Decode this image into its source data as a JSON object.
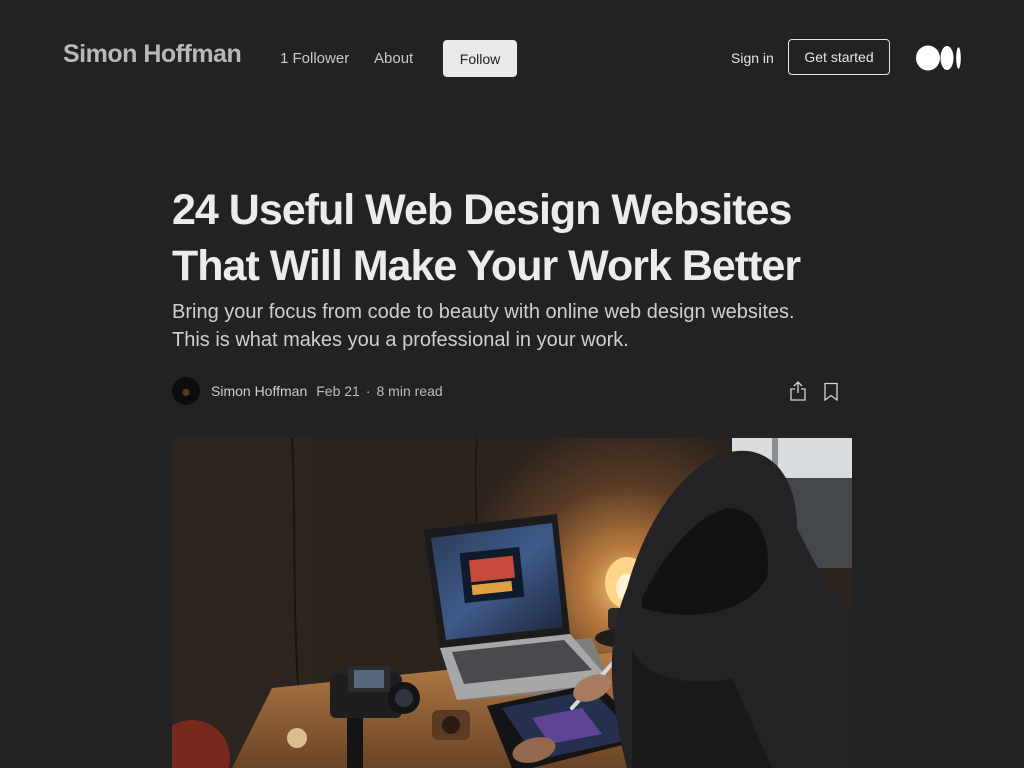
{
  "header": {
    "brand": "Simon Hoffman",
    "followers": "1 Follower",
    "about": "About",
    "follow_label": "Follow",
    "sign_in": "Sign in",
    "get_started": "Get started",
    "logo_icon": "medium-logo-icon"
  },
  "article": {
    "title": "24 Useful Web Design Websites That Will Make Your Work Better",
    "subtitle": "Bring your focus from code to beauty with online web design websites. This is what makes you a professional in your work.",
    "author": "Simon Hoffman",
    "date": "Feb 21",
    "separator": "·",
    "read_time": "8 min read",
    "share_icon": "share-icon",
    "bookmark_icon": "bookmark-icon"
  },
  "colors": {
    "background": "#222222",
    "button_bg": "#e9e9e9",
    "text": "#e6e6e6"
  }
}
